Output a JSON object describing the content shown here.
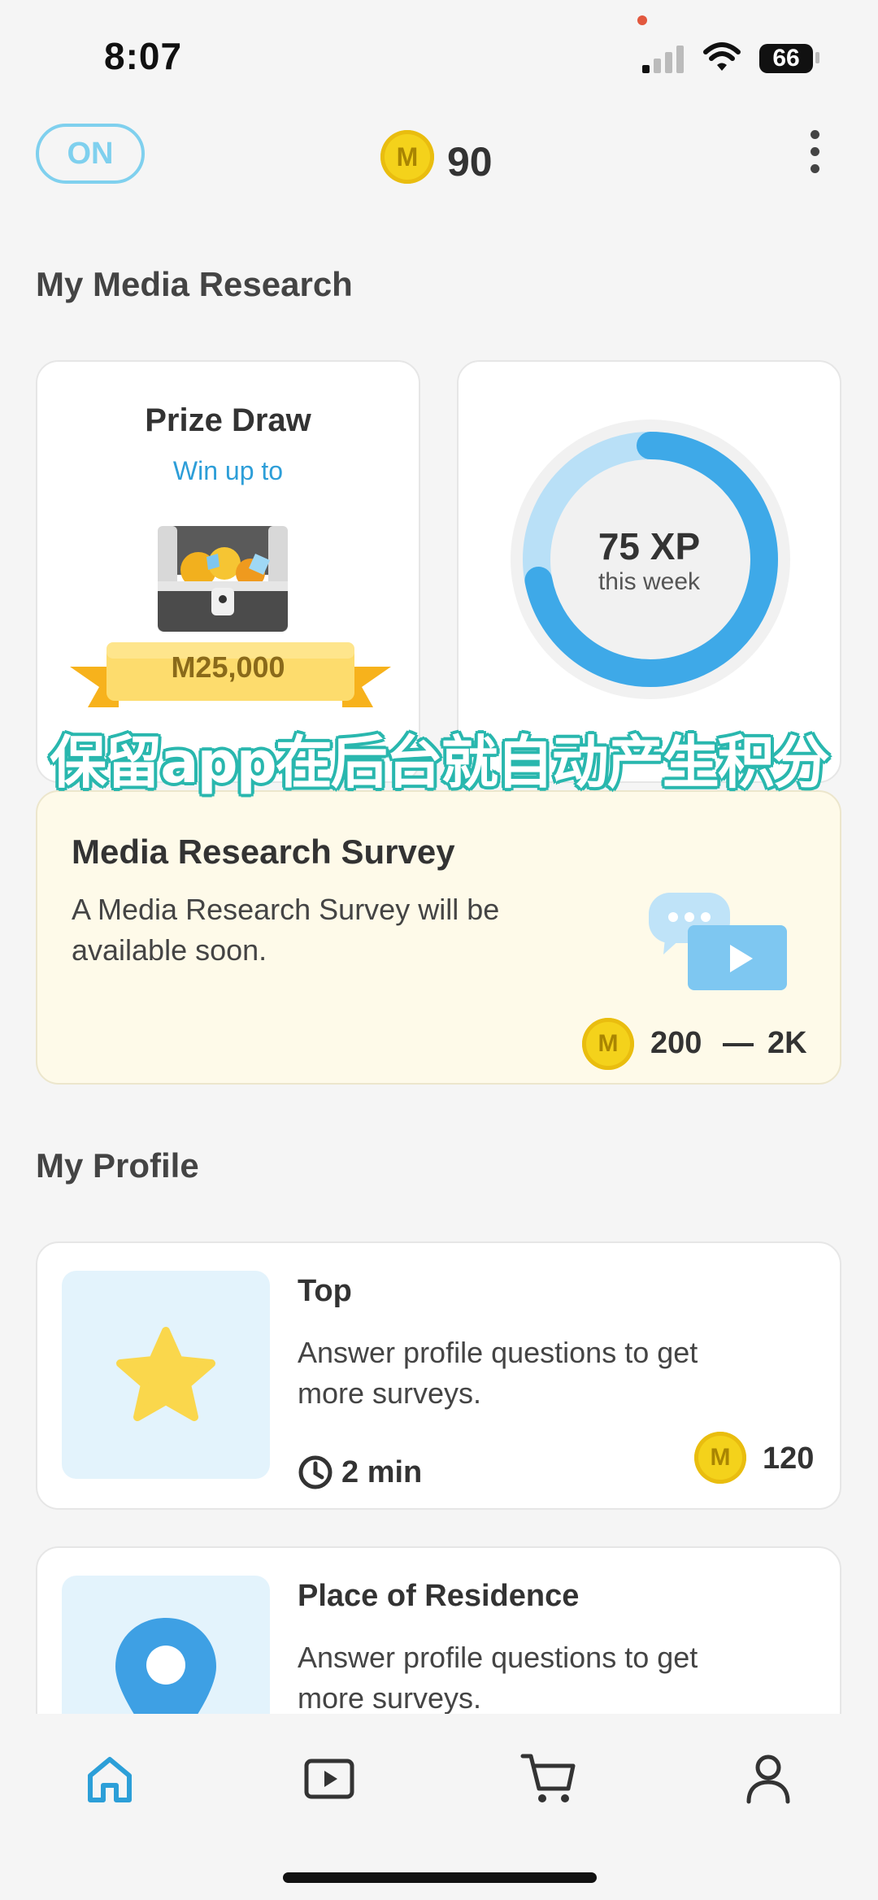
{
  "status_bar": {
    "time": "8:07",
    "battery": "66"
  },
  "header": {
    "toggle_label": "ON",
    "coin_symbol": "M",
    "coin_balance": "90"
  },
  "sections": {
    "media_research": "My Media Research",
    "profile": "My Profile"
  },
  "prize_draw": {
    "title": "Prize Draw",
    "subtitle": "Win up to",
    "amount": "M25,000"
  },
  "xp": {
    "value": "75 XP",
    "label": "this week",
    "progress": 0.72
  },
  "overlay_caption": "保留app在后台就自动产生积分",
  "survey": {
    "title": "Media Research Survey",
    "description": "A Media Research Survey will be available soon.",
    "reward_min": "200",
    "reward_max": "2K"
  },
  "profile_cards": [
    {
      "title": "Top",
      "description": "Answer profile questions to get more surveys.",
      "time": "2 min",
      "reward": "120",
      "icon": "star-icon"
    },
    {
      "title": "Place of Residence",
      "description": "Answer profile questions to get more surveys.",
      "icon": "location-pin-icon"
    }
  ],
  "nav": [
    "home-icon",
    "video-play-icon",
    "cart-icon",
    "profile-icon"
  ],
  "colors": {
    "accent": "#3ea9e8",
    "coin": "#f4d21b",
    "toggle": "#7fd0ee",
    "survey_bg": "#fefae9"
  }
}
